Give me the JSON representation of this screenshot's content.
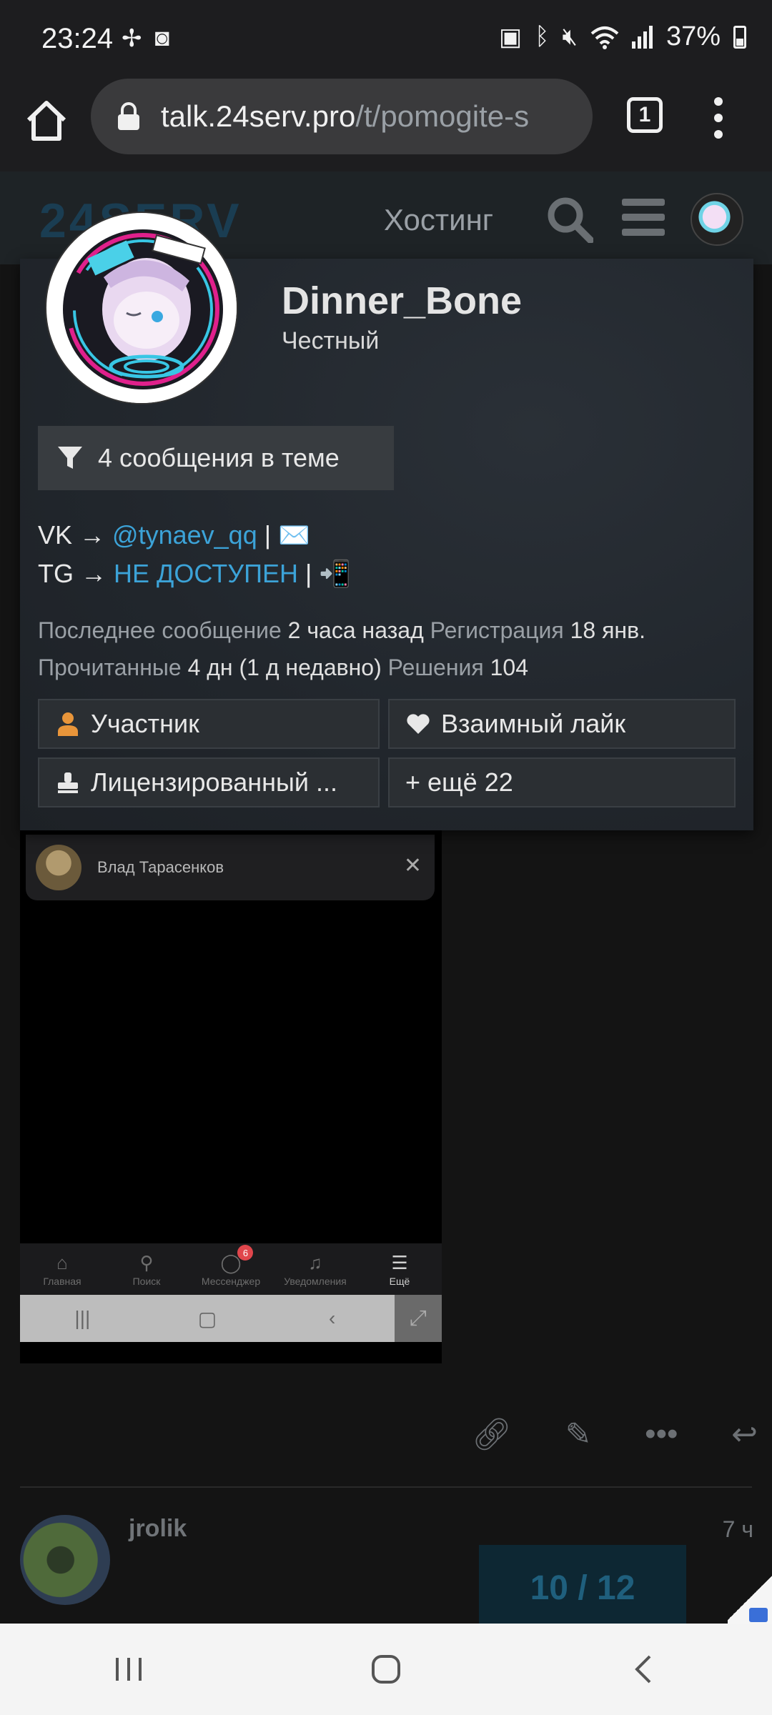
{
  "status_bar": {
    "time": "23:24",
    "battery": "37%"
  },
  "browser": {
    "url_host": "talk.24serv.pro",
    "url_path": "/t/pomogite-s",
    "tab_count": "1"
  },
  "site_header": {
    "logo": "24SERV",
    "nav_label": "Хостинг"
  },
  "user_card": {
    "username": "Dinner_Bone",
    "title": "Честный",
    "filter_button": "4 сообщения в теме",
    "bio": {
      "vk_prefix": "VK →",
      "vk_link": "@tynaev_qq",
      "vk_sep": "|",
      "tg_prefix": "TG →",
      "tg_link": "НЕ ДОСТУПЕН",
      "tg_sep": "|"
    },
    "stats": {
      "last_post_label": "Последнее сообщение",
      "last_post_value": "2 часа назад",
      "joined_label": "Регистрация",
      "joined_value": "18 янв.",
      "read_label": "Прочитанные",
      "read_value": "4 дн (1 д недавно)",
      "solutions_label": "Решения",
      "solutions_value": "104"
    },
    "badges": [
      {
        "label": "Участник",
        "icon": "user-icon",
        "color": "#e8953a"
      },
      {
        "label": "Взаимный лайк",
        "icon": "heart-icon",
        "color": "#e8e8e8"
      },
      {
        "label": "Лицензированный ...",
        "icon": "stamp-icon",
        "color": "#e8e8e8"
      },
      {
        "label": "+ ещё 22",
        "icon": "",
        "color": ""
      }
    ]
  },
  "post": {
    "video_user": "Влад Тарасенков",
    "app_nav": [
      {
        "label": "Главная",
        "icon": "home-icon"
      },
      {
        "label": "Поиск",
        "icon": "search-icon"
      },
      {
        "label": "Мессенджер",
        "icon": "chat-icon",
        "badge": "6"
      },
      {
        "label": "Уведомления",
        "icon": "bell-icon"
      },
      {
        "label": "Ещё",
        "icon": "menu-icon"
      }
    ]
  },
  "reply": {
    "username": "jrolik",
    "time": "7 ч"
  },
  "timeline": {
    "current": "10",
    "separator": "/",
    "total": "12"
  },
  "colors": {
    "accent_link": "#3ca3d8",
    "card_bg": "#21262c",
    "badge_user": "#e8953a"
  }
}
